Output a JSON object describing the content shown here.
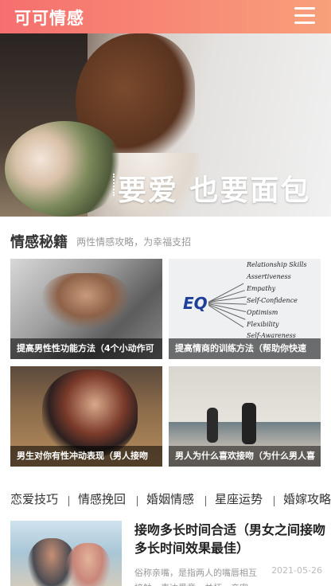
{
  "header": {
    "logo": "可可情感",
    "menu_icon": "hamburger-menu-icon",
    "gradient_start": "#f66f6f",
    "gradient_end": "#f8a07a"
  },
  "banner": {
    "text": "要爱 也要面包",
    "active_dot_color": "#f2636a",
    "slide_count_visible": 1,
    "active_index": 1
  },
  "section": {
    "title": "情感秘籍",
    "subtitle": "两性情感攻略，为幸福支招"
  },
  "cards": [
    {
      "caption": "提高男性性功能方法（4个小动作可"
    },
    {
      "caption": "提高情商的训练方法（帮助你快速"
    },
    {
      "caption": "男生对你有性冲动表现（男人接吻"
    },
    {
      "caption": "男人为什么喜欢接吻（为什么男人喜"
    }
  ],
  "eq_image": {
    "label": "EQ",
    "skills": [
      "Relationship Skills",
      "Assertiveness",
      "Empathy",
      "Self-Confidence",
      "Optimism",
      "Flexibility",
      "Self-Awareness"
    ]
  },
  "tabs": [
    {
      "label": "恋爱技巧"
    },
    {
      "label": "情感挽回"
    },
    {
      "label": "婚姻情感"
    },
    {
      "label": "星座运势"
    },
    {
      "label": "婚嫁攻略"
    }
  ],
  "article": {
    "title": "接吻多长时间合适（男女之间接吻多长时间效果最佳）",
    "excerpt": "俗称亲嘴，是指两人的嘴唇相互接触，表达爱意、关怀、亲密",
    "date": "2021-05-26"
  }
}
